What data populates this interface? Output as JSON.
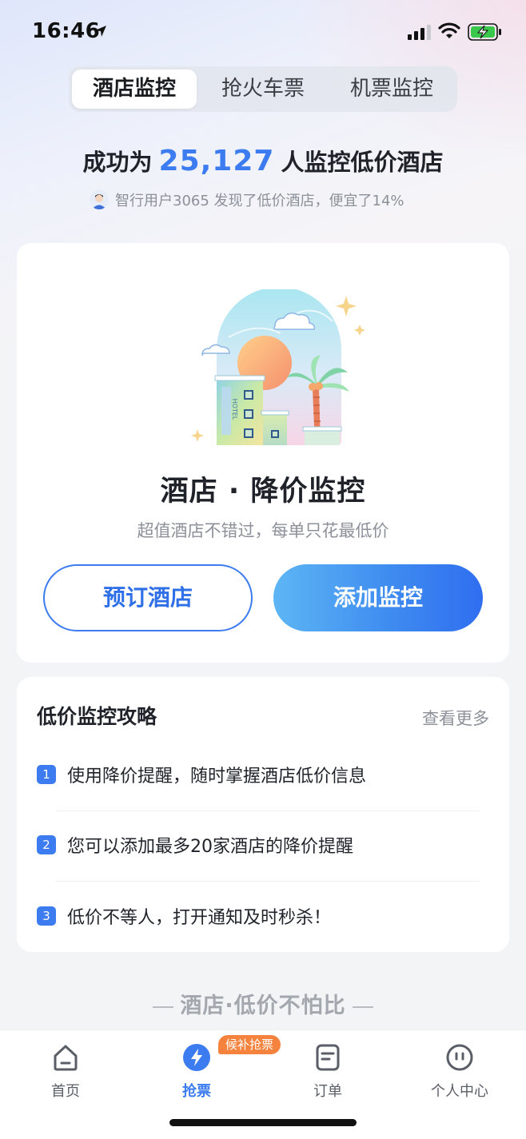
{
  "status_bar": {
    "time": "16:46"
  },
  "tabs": [
    {
      "label": "酒店监控",
      "active": true
    },
    {
      "label": "抢火车票",
      "active": false
    },
    {
      "label": "机票监控",
      "active": false
    }
  ],
  "headline": {
    "prefix": "成功为",
    "count": "25,127",
    "suffix": "人监控低价酒店"
  },
  "subline": "智行用户3065 发现了低价酒店，便宜了14%",
  "main_card": {
    "title": "酒店 · 降价监控",
    "subtitle": "超值酒店不错过，每单只花最低价",
    "book_button": "预订酒店",
    "add_button": "添加监控",
    "hotel_sign": "HOTEL"
  },
  "tips": {
    "title": "低价监控攻略",
    "more": "查看更多",
    "items": [
      {
        "num": "1",
        "text": "使用降价提醒，随时掌握酒店低价信息"
      },
      {
        "num": "2",
        "text": "您可以添加最多20家酒店的降价提醒"
      },
      {
        "num": "3",
        "text": "低价不等人，打开通知及时秒杀！"
      }
    ]
  },
  "slogan": "酒店·低价不怕比",
  "nav": {
    "badge": "候补抢票",
    "items": [
      {
        "label": "首页",
        "icon": "home-icon"
      },
      {
        "label": "抢票",
        "icon": "lightning-icon",
        "active": true
      },
      {
        "label": "订单",
        "icon": "order-icon"
      },
      {
        "label": "个人中心",
        "icon": "profile-icon"
      }
    ]
  },
  "colors": {
    "accent": "#3d7cf0",
    "badge": "#f5823d"
  }
}
